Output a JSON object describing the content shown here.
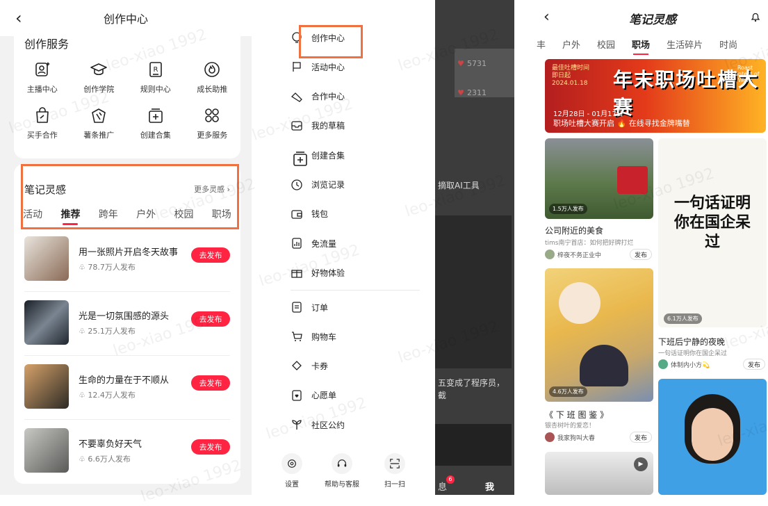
{
  "left": {
    "title": "创作中心",
    "services_heading": "创作服务",
    "services": [
      {
        "label": "主播中心",
        "icon": "anchor-icon"
      },
      {
        "label": "创作学院",
        "icon": "graduation-cap-icon"
      },
      {
        "label": "规则中心",
        "icon": "rules-icon"
      },
      {
        "label": "成长助推",
        "icon": "flame-icon"
      },
      {
        "label": "买手合作",
        "icon": "shopping-bag-icon"
      },
      {
        "label": "薯条推广",
        "icon": "fries-icon"
      },
      {
        "label": "创建合集",
        "icon": "collection-add-icon"
      },
      {
        "label": "更多服务",
        "icon": "more-grid-icon"
      }
    ],
    "inspiration_heading": "笔记灵感",
    "more_label": "更多灵感",
    "tabs": [
      "活动",
      "推荐",
      "跨年",
      "户外",
      "校园",
      "职场"
    ],
    "active_tab": "推荐",
    "items": [
      {
        "title": "用一张照片开启冬天故事",
        "count": "78.7万人发布",
        "button": "去发布"
      },
      {
        "title": "光是一切氛围感的源头",
        "count": "25.1万人发布",
        "button": "去发布"
      },
      {
        "title": "生命的力量在于不顺从",
        "count": "12.4万人发布",
        "button": "去发布"
      },
      {
        "title": "不要辜负好天气",
        "count": "6.6万人发布",
        "button": "去发布"
      }
    ]
  },
  "middle": {
    "menu": [
      {
        "label": "创作中心",
        "icon": "lightbulb-icon"
      },
      {
        "label": "活动中心",
        "icon": "flag-icon"
      },
      {
        "label": "合作中心",
        "icon": "handshake-icon"
      },
      {
        "label": "我的草稿",
        "icon": "inbox-icon"
      },
      {
        "label": "创建合集",
        "icon": "collection-add-icon"
      },
      {
        "label": "浏览记录",
        "icon": "clock-icon"
      },
      {
        "label": "钱包",
        "icon": "wallet-icon"
      },
      {
        "label": "免流量",
        "icon": "data-chart-icon"
      },
      {
        "label": "好物体验",
        "icon": "gift-icon"
      }
    ],
    "menu2": [
      {
        "label": "订单",
        "icon": "order-icon"
      },
      {
        "label": "购物车",
        "icon": "cart-icon"
      },
      {
        "label": "卡券",
        "icon": "ticket-icon"
      },
      {
        "label": "心愿单",
        "icon": "wishlist-icon"
      },
      {
        "label": "社区公约",
        "icon": "sprout-icon"
      }
    ],
    "bottom": [
      {
        "label": "设置",
        "icon": "settings-icon"
      },
      {
        "label": "帮助与客服",
        "icon": "headset-icon"
      },
      {
        "label": "扫一扫",
        "icon": "scan-icon"
      }
    ],
    "shade_texts": {
      "n1": "5731",
      "n2": "2311",
      "t1": "摘取AI工具",
      "t2": "五变成了程序员，",
      "t3": "截",
      "msg": "息",
      "me": "我",
      "badge": "6"
    }
  },
  "right": {
    "title": "笔记灵感",
    "tabs": [
      "丰",
      "户外",
      "校园",
      "职场",
      "生活碎片",
      "时尚"
    ],
    "active_tab": "职场",
    "banner": {
      "tag": "最佳吐槽时间",
      "sub": "即日起",
      "date": "2024.01.18",
      "headline": "年末职场吐槽大赛",
      "roast": "Roast Contest of Work",
      "dates": "12月28日 - 01月17日",
      "desc": "职场吐槽大赛开启 🔥 在线寻找金牌嘴替"
    },
    "notes": [
      {
        "badge": "1.5万人发布",
        "title": "公司附近的美食",
        "sub": "tims南宁首店：如何把好牌打烂",
        "author": "梓夜不务正业中",
        "btn": "发布"
      },
      {
        "badge": "6.1万人发布",
        "title": "下班后宁静的夜晚",
        "sub": "一句话证明你在国企呆过",
        "author": "体制内小方💫",
        "btn": "发布",
        "img_text": "一句话证明你在国企呆过"
      },
      {
        "badge": "4.6万人发布",
        "title": "《 下 班 图 鉴 》",
        "sub": "银杏树叶的爱恋！",
        "author": "我家狗叫大春",
        "btn": "发布"
      }
    ]
  },
  "watermark": "leo-xiao 1992",
  "colors": {
    "accent": "#ff2442",
    "highlight": "#f0703f"
  }
}
